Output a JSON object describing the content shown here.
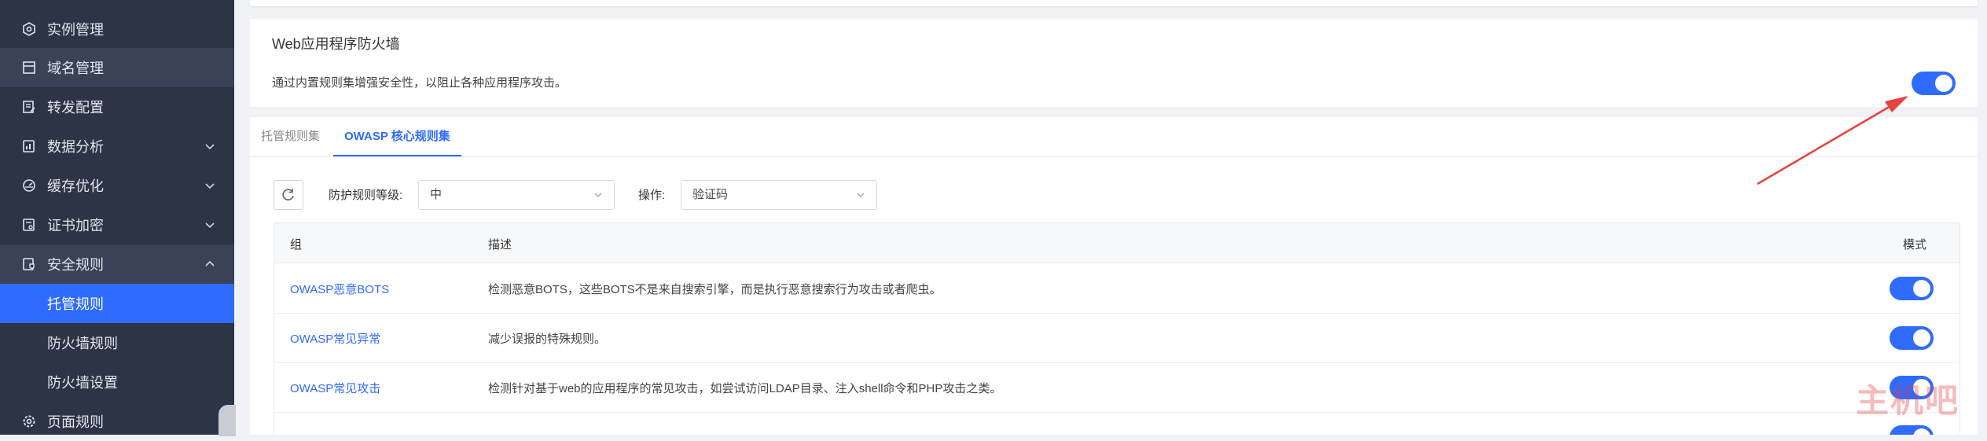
{
  "sidebar": {
    "items": [
      {
        "label": "实例管理",
        "icon": "hexagon-gear-icon",
        "state": "normal",
        "chevron": ""
      },
      {
        "label": "域名管理",
        "icon": "browser-window-icon",
        "state": "highlight",
        "chevron": ""
      },
      {
        "label": "转发配置",
        "icon": "edit-doc-icon",
        "state": "normal",
        "chevron": ""
      },
      {
        "label": "数据分析",
        "icon": "chart-doc-icon",
        "state": "normal",
        "chevron": "down"
      },
      {
        "label": "缓存优化",
        "icon": "gauge-icon",
        "state": "normal",
        "chevron": "down"
      },
      {
        "label": "证书加密",
        "icon": "certificate-icon",
        "state": "normal",
        "chevron": "down"
      },
      {
        "label": "安全规则",
        "icon": "shield-doc-icon",
        "state": "highlight",
        "chevron": "up"
      },
      {
        "label": "托管规则",
        "icon": "",
        "state": "active",
        "chevron": ""
      },
      {
        "label": "防火墙规则",
        "icon": "",
        "state": "sub",
        "chevron": ""
      },
      {
        "label": "防火墙设置",
        "icon": "",
        "state": "sub",
        "chevron": ""
      },
      {
        "label": "页面规则",
        "icon": "gear-icon",
        "state": "normal",
        "chevron": ""
      }
    ]
  },
  "waf": {
    "title": "Web应用程序防火墙",
    "description": "通过内置规则集增强安全性，以阻止各种应用程序攻击。",
    "enabled": true
  },
  "tabs": [
    {
      "label": "托管规则集",
      "active": false
    },
    {
      "label": "OWASP 核心规则集",
      "active": true
    }
  ],
  "filters": {
    "level_label": "防护规则等级:",
    "level_value": "中",
    "action_label": "操作:",
    "action_value": "验证码"
  },
  "table": {
    "headers": {
      "group": "组",
      "desc": "描述",
      "mode": "模式"
    },
    "rows": [
      {
        "group": "OWASP恶意BOTS",
        "desc": "检测恶意BOTS，这些BOTS不是来自搜索引擎，而是执行恶意搜索行为攻击或者爬虫。",
        "enabled": true
      },
      {
        "group": "OWASP常见异常",
        "desc": "减少误报的特殊规则。",
        "enabled": true
      },
      {
        "group": "OWASP常见攻击",
        "desc": "检测针对基于web的应用程序的常见攻击，如尝试访问LDAP目录、注入shell命令和PHP攻击之类。",
        "enabled": true
      },
      {
        "group": "",
        "desc": "",
        "enabled": true
      }
    ]
  },
  "colors": {
    "accent": "#2f6bff",
    "sidebar_bg": "#2c3446",
    "arrow": "#e8413c"
  },
  "watermark": "主机吧"
}
